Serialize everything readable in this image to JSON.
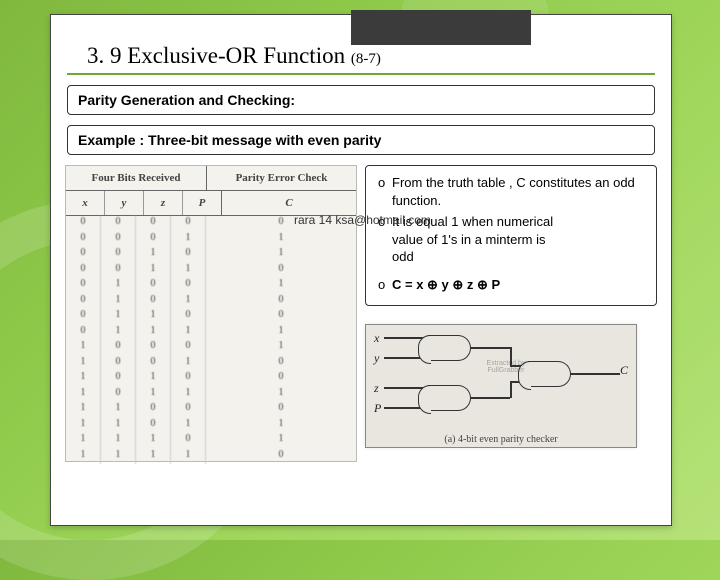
{
  "title_main": "3. 9 Exclusive-OR Function",
  "title_sub": "(8-7)",
  "box1": "Parity Generation and Checking:",
  "box2": "Example : Three-bit message with even parity",
  "table": {
    "head_left": "Four Bits Received",
    "head_right": "Parity Error Check",
    "vars": [
      "x",
      "y",
      "z",
      "P",
      "C"
    ],
    "rows": [
      [
        "0",
        "0",
        "0",
        "0",
        "0"
      ],
      [
        "0",
        "0",
        "0",
        "1",
        "1"
      ],
      [
        "0",
        "0",
        "1",
        "0",
        "1"
      ],
      [
        "0",
        "0",
        "1",
        "1",
        "0"
      ],
      [
        "0",
        "1",
        "0",
        "0",
        "1"
      ],
      [
        "0",
        "1",
        "0",
        "1",
        "0"
      ],
      [
        "0",
        "1",
        "1",
        "0",
        "0"
      ],
      [
        "0",
        "1",
        "1",
        "1",
        "1"
      ],
      [
        "1",
        "0",
        "0",
        "0",
        "1"
      ],
      [
        "1",
        "0",
        "0",
        "1",
        "0"
      ],
      [
        "1",
        "0",
        "1",
        "0",
        "0"
      ],
      [
        "1",
        "0",
        "1",
        "1",
        "1"
      ],
      [
        "1",
        "1",
        "0",
        "0",
        "0"
      ],
      [
        "1",
        "1",
        "0",
        "1",
        "1"
      ],
      [
        "1",
        "1",
        "1",
        "0",
        "1"
      ],
      [
        "1",
        "1",
        "1",
        "1",
        "0"
      ]
    ]
  },
  "bullets": {
    "b1": "From the truth table , C constitutes an odd function.",
    "b2a": "It is equal 1 when numerical",
    "b2b": "value of 1's in a minterm is",
    "b2c": "odd",
    "b3": "C = x ⊕ y ⊕ z ⊕ P"
  },
  "email": "rara 14 ksa@hotmail.com",
  "circuit": {
    "x": "x",
    "y": "y",
    "z": "z",
    "p": "P",
    "c": "C",
    "caption": "(a) 4-bit even parity checker",
    "brand": "Extracted by FullGrabber"
  }
}
